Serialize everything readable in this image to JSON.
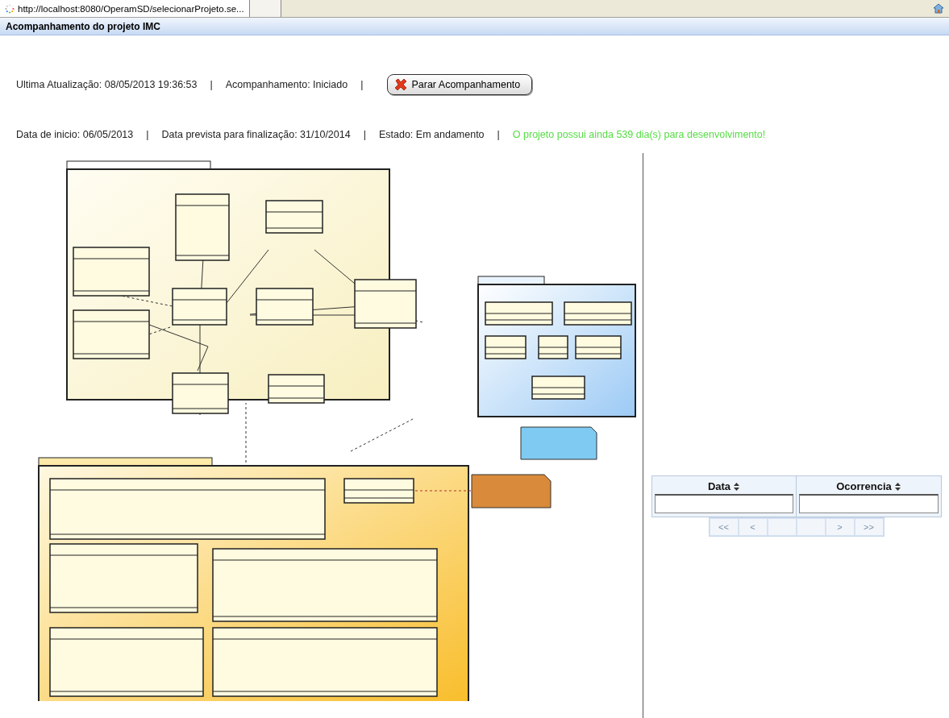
{
  "browser": {
    "tab_title": "http://localhost:8080/OperamSD/selecionarProjeto.se..."
  },
  "header": {
    "title": "Acompanhamento do projeto IMC"
  },
  "status_row": [
    {
      "kind": "text",
      "text": "Ultima Atualização: 08/05/2013 19:36:53"
    },
    {
      "kind": "text",
      "text": "Acompanhamento: Iniciado"
    },
    {
      "kind": "button",
      "text": "Parar Acompanhamento"
    }
  ],
  "dates_row": [
    {
      "kind": "text",
      "text": "Data de inicio: 06/05/2013"
    },
    {
      "kind": "text",
      "text": "Data prevista para finalização: 31/10/2014"
    },
    {
      "kind": "text",
      "text": "Estado: Em andamento"
    },
    {
      "kind": "notice",
      "text": "O projeto possui ainda 539 dia(s) para desenvolvimento!"
    }
  ],
  "separator": "|",
  "diagram": {
    "kind": "picture"
  },
  "table": {
    "columns": [
      {
        "label": "Data"
      },
      {
        "label": "Ocorrencia"
      }
    ],
    "pager": [
      {
        "kind": "nav",
        "label": "<<",
        "disabled": true
      },
      {
        "kind": "nav",
        "label": "<",
        "disabled": true
      },
      {
        "kind": "blank"
      },
      {
        "kind": "blank"
      },
      {
        "kind": "nav",
        "label": ">",
        "disabled": true
      },
      {
        "kind": "nav",
        "label": ">>",
        "disabled": true
      }
    ]
  }
}
